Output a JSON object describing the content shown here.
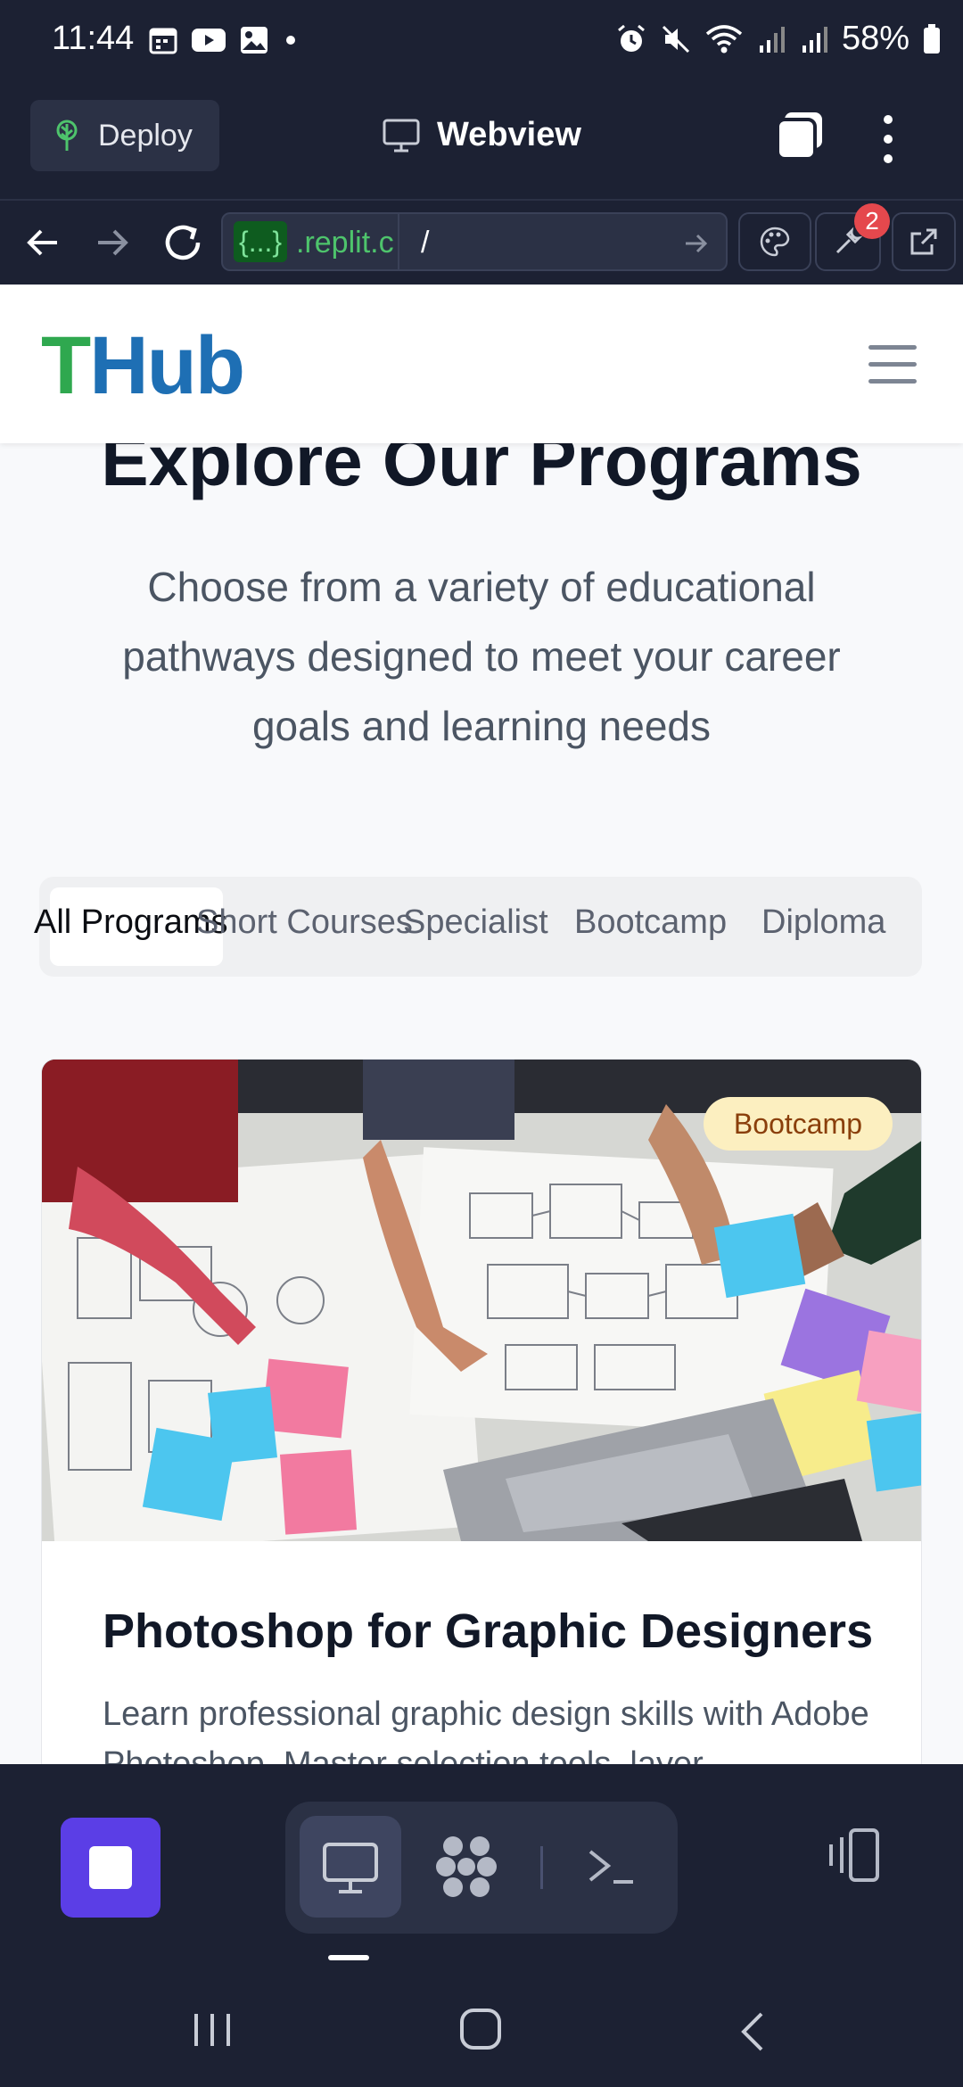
{
  "status_bar": {
    "time": "11:44",
    "battery": "58%",
    "left_icons": [
      "calendar-icon",
      "youtube-icon",
      "gallery-icon",
      "dot-icon"
    ],
    "right_icons": [
      "alarm-icon",
      "mute-icon",
      "wifi-icon",
      "signal-icon",
      "signal-icon",
      "battery-icon"
    ]
  },
  "replit_header": {
    "deploy_label": "Deploy",
    "title": "Webview"
  },
  "url_bar": {
    "host_badge": "{...}",
    "host": ".replit.c",
    "path": "/",
    "devtools_badge": "2"
  },
  "site": {
    "logo_t": "T",
    "logo_hub": "Hub",
    "programs_title": "Explore Our Programs",
    "programs_subtitle": "Choose from a variety of educational pathways designed to meet your career goals and learning needs",
    "tabs": [
      {
        "label": "All Programs",
        "active": true
      },
      {
        "label": "Short Courses",
        "active": false
      },
      {
        "label": "Specialist",
        "active": false
      },
      {
        "label": "Bootcamp",
        "active": false
      },
      {
        "label": "Diploma",
        "active": false
      }
    ],
    "card": {
      "badge": "Bootcamp",
      "title": "Photoshop for Graphic Designers",
      "description": "Learn professional graphic design skills with Adobe Photoshop. Master selection tools, layer"
    }
  },
  "colors": {
    "brand_green": "#2fa84f",
    "brand_blue": "#1e6fb4",
    "replit_bg": "#1c2133",
    "stop_purple": "#5b3ee6",
    "badge_bg": "#fcefc0",
    "badge_text": "#8a3f0b"
  }
}
